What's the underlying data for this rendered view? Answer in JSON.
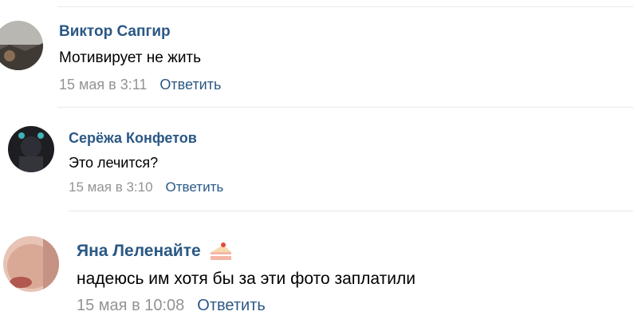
{
  "comments": [
    {
      "author": "Виктор Сапгир",
      "text": "Мотивирует не жить",
      "date": "15 мая в 3:11",
      "reply_label": "Ответить",
      "avatar_icon": "landscape-photo-avatar"
    },
    {
      "author": "Серёжа Конфетов",
      "text": "Это лечится?",
      "date": "15 мая в 3:10",
      "reply_label": "Ответить",
      "avatar_icon": "dark-portrait-avatar"
    },
    {
      "author": "Яна Леленайте",
      "text": "надеюсь им хотя бы за эти фото заплатили",
      "date": "15 мая в 10:08",
      "reply_label": "Ответить",
      "avatar_icon": "face-closeup-avatar",
      "badge_icon": "cake-icon"
    }
  ],
  "colors": {
    "author": "#2a5885",
    "reply": "#2a5885",
    "meta": "#939393",
    "text": "#000000",
    "divider": "#e7e8ec"
  }
}
